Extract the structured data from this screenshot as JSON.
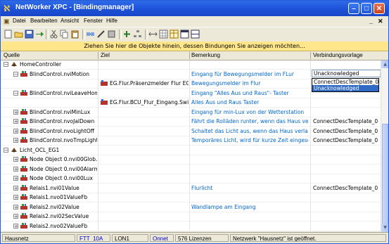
{
  "window": {
    "title": "NetWorker XPC - [Bindingmanager]",
    "minimize": "–",
    "maximize": "□",
    "close": "✕"
  },
  "menu": {
    "items": [
      "Datei",
      "Bearbeiten",
      "Ansicht",
      "Fenster",
      "Hilfe"
    ],
    "mdi_min": "_",
    "mdi_close": "✕"
  },
  "hint": "Ziehen Sie hier die Objekte hinein, dessen Bindungen Sie anzeigen möchten...",
  "columns": [
    "Quelle",
    "Ziel",
    "Bemerkung",
    "Verbindungsvorlage"
  ],
  "rows": [
    {
      "source": "HomeController",
      "target": "",
      "remark": "",
      "template": "",
      "level": 0,
      "expander": "−",
      "icon": "controller-icon"
    },
    {
      "source": "BlindControl.nviMotion",
      "target": "",
      "remark": "Eingang für Bewegungsmelder im FLur",
      "template": "",
      "level": 1,
      "expander": "−",
      "icon": "binding-icon"
    },
    {
      "source": "",
      "target": "EG.Flur.Präsenzmelder Flur EG.nv...",
      "remark": "Bewegungsmelder im Flur",
      "template": "ConnectDescTemplate_0",
      "level": 2,
      "expander": "",
      "icon": "target-icon"
    },
    {
      "source": "BlindControl.nviLeaveHome",
      "target": "",
      "remark": "Eingang \"Alles Aus und Raus\"- Taster",
      "template": "",
      "level": 1,
      "expander": "−",
      "icon": "binding-icon"
    },
    {
      "source": "",
      "target": "EG.Flur.BCU_Flur_Eingang.Switc...",
      "remark": "Alles Aus und Raus Taster",
      "template": "",
      "level": 2,
      "expander": "",
      "icon": "target-icon"
    },
    {
      "source": "BlindControl.nviMinLux",
      "target": "",
      "remark": "Eingang für min-Lux von der Wetterstation",
      "template": "",
      "level": 1,
      "expander": "+",
      "icon": "binding-icon"
    },
    {
      "source": "BlindControl.nvoJalDown",
      "target": "",
      "remark": "Fährt die Rolläden runter, wenn das Haus verlassen ...",
      "template": "ConnectDescTemplate_0",
      "level": 1,
      "expander": "+",
      "icon": "binding-icon"
    },
    {
      "source": "BlindControl.nvoLightOff",
      "target": "",
      "remark": "Schaltet das Licht aus, wenn das Haus verlassen wi...",
      "template": "ConnectDescTemplate_0",
      "level": 1,
      "expander": "+",
      "icon": "binding-icon"
    },
    {
      "source": "BlindControl.nvoTmpLight",
      "target": "",
      "remark": "Temporäres Licht, wird für kurze Zeit eingeschaltet, ...",
      "template": "ConnectDescTemplate_0",
      "level": 1,
      "expander": "+",
      "icon": "binding-icon"
    },
    {
      "source": "Licht_OCL_EG1",
      "target": "",
      "remark": "",
      "template": "",
      "level": 0,
      "expander": "−",
      "icon": "controller-icon"
    },
    {
      "source": "Node Object 0.nvi00Glob...",
      "target": "",
      "remark": "",
      "template": "",
      "level": 1,
      "expander": "+",
      "icon": "binding-icon"
    },
    {
      "source": "Node Object 0.nvi00Alarm",
      "target": "",
      "remark": "",
      "template": "",
      "level": 1,
      "expander": "+",
      "icon": "binding-icon"
    },
    {
      "source": "Node Object 0.nvi00Lux",
      "target": "",
      "remark": "",
      "template": "",
      "level": 1,
      "expander": "+",
      "icon": "binding-icon"
    },
    {
      "source": "Relais1.nvi01Value",
      "target": "",
      "remark": "Flurlicht",
      "template": "ConnectDescTemplate_0",
      "level": 1,
      "expander": "+",
      "icon": "binding-icon"
    },
    {
      "source": "Relais1.nvo01ValueFb",
      "target": "",
      "remark": "",
      "template": "",
      "level": 1,
      "expander": "+",
      "icon": "binding-icon"
    },
    {
      "source": "Relais2.nvi02Value",
      "target": "",
      "remark": "Wandlampe am Eingang",
      "template": "",
      "level": 1,
      "expander": "+",
      "icon": "binding-icon"
    },
    {
      "source": "Relais2.nvi02SecValue",
      "target": "",
      "remark": "",
      "template": "",
      "level": 1,
      "expander": "+",
      "icon": "binding-icon"
    },
    {
      "source": "Relais2.nvo02ValueFb",
      "target": "",
      "remark": "",
      "template": "",
      "level": 1,
      "expander": "+",
      "icon": "binding-icon"
    }
  ],
  "dropdown": {
    "value": "Unacknowledged",
    "options": [
      "ConnectDescTemplate_0",
      "Unacknowledged"
    ],
    "selected_index": 1
  },
  "status": {
    "network": "Hausnetz",
    "ft": "FTT_10A",
    "channel": "LON1",
    "mode": "Onnet",
    "licenses": "576 Lizenzen",
    "message": "Netzwerk \"Hausnetz\" ist geöffnet."
  },
  "colors": {
    "titlebar": "#1c4fd6",
    "hint_bg": "#ffe68a",
    "remark_text": "#0066cc",
    "selection": "#316ac5"
  }
}
